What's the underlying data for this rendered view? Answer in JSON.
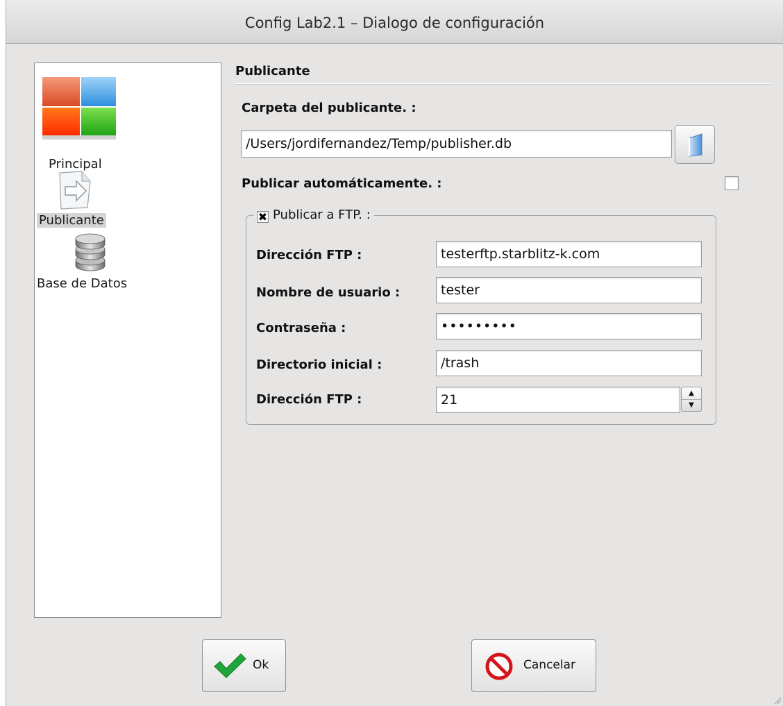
{
  "window": {
    "title": "Config Lab2.1 – Dialogo de configuración"
  },
  "sidebar": {
    "items": [
      {
        "label": "Principal",
        "icon": "principal-tiles-icon",
        "selected": false
      },
      {
        "label": "Publicante",
        "icon": "publish-arrow-icon",
        "selected": true
      },
      {
        "label": "Base de Datos",
        "icon": "database-icon",
        "selected": false
      }
    ]
  },
  "section": {
    "title": "Publicante"
  },
  "publisher": {
    "folder_label": "Carpeta del publicante. :",
    "folder_value": "/Users/jordifernandez/Temp/publisher.db",
    "auto_label": "Publicar automáticamente. :",
    "auto_checked": false,
    "ftp_group_label": "Publicar a FTP. :",
    "ftp_group_checked": true,
    "ftp_address_label": "Dirección FTP :",
    "ftp_address_value": "testerftp.starblitz-k.com",
    "username_label": "Nombre de usuario :",
    "username_value": "tester",
    "password_label": "Contraseña :",
    "password_value": "•••••••••",
    "initial_dir_label": "Directorio inicial :",
    "initial_dir_value": "/trash",
    "port_label": "Dirección FTP :",
    "port_value": "21"
  },
  "buttons": {
    "ok_label": "Ok",
    "cancel_label": "Cancelar"
  },
  "colors": {
    "window_bg": "#e6e5e4",
    "ok_check": "#1fa53a",
    "cancel_red": "#d3141b"
  }
}
